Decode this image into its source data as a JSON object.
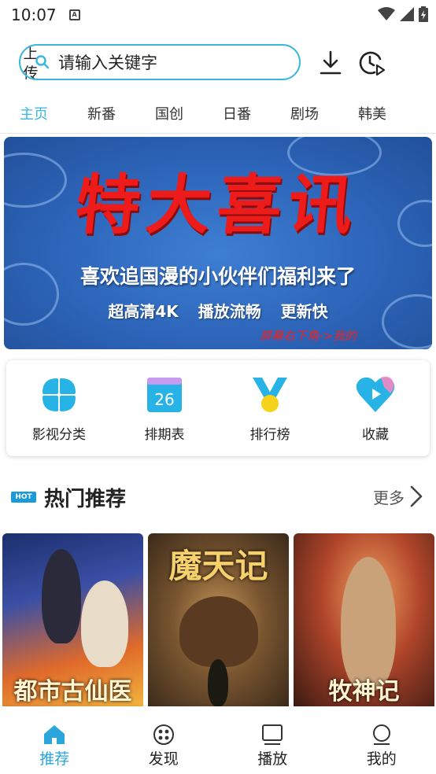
{
  "status": {
    "time": "10:07"
  },
  "search": {
    "placeholder": "请输入关键字",
    "upload_label": "上传"
  },
  "tabs": [
    "主页",
    "新番",
    "国创",
    "日番",
    "剧场",
    "韩美"
  ],
  "banner": {
    "headline": "特大喜讯",
    "subtitle": "喜欢追国漫的小伙伴们福利来了",
    "features": "超高清4K 播放流畅 更新快",
    "note": "屏幕右下角->我的"
  },
  "quick_links": [
    {
      "label": "影视分类",
      "icon": "category-icon"
    },
    {
      "label": "排期表",
      "icon": "calendar-icon",
      "badge": "26"
    },
    {
      "label": "排行榜",
      "icon": "medal-icon"
    },
    {
      "label": "收藏",
      "icon": "heart-play-icon"
    }
  ],
  "section": {
    "badge": "HOT",
    "title": "热门推荐",
    "more": "更多"
  },
  "posters": [
    {
      "title": "都市古仙医"
    },
    {
      "title": "魔天记"
    },
    {
      "title": "牧神记"
    }
  ],
  "nav": [
    {
      "label": "推荐",
      "icon": "home-icon",
      "active": true
    },
    {
      "label": "发现",
      "icon": "film-reel-icon"
    },
    {
      "label": "播放",
      "icon": "screen-icon"
    },
    {
      "label": "我的",
      "icon": "user-icon"
    }
  ],
  "colors": {
    "accent": "#3bb6dc",
    "banner_red": "#ee1b1b",
    "banner_blue": "#2c64b8"
  }
}
